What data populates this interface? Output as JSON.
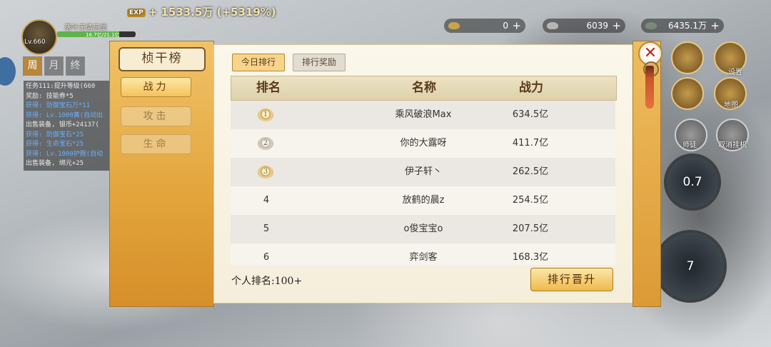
{
  "hud": {
    "exp_badge": "EXP",
    "exp_text": "+ 1533.5万 (+5319%)",
    "player_level": "Lv.660",
    "player_name": "落叶无情忘属",
    "hp_text": "16.7亿/21.1亿",
    "hp_fraction": 0.79,
    "resources": [
      {
        "icon": "gold-ingot-icon",
        "value": "0"
      },
      {
        "icon": "silver-ingot-icon",
        "value": "6039"
      },
      {
        "icon": "copper-coin-icon",
        "value": "6435.1万"
      }
    ],
    "plus": "+",
    "time_tabs": [
      "周",
      "月",
      "终"
    ]
  },
  "quest_log": [
    {
      "text": "任务111:提升等级(660",
      "cls": ""
    },
    {
      "text": "奖励: 技能券*5",
      "cls": ""
    },
    {
      "text": "获得: 防御宝石万*11",
      "cls": "b"
    },
    {
      "text": "获得: Lv.1000黄(自动出",
      "cls": "b"
    },
    {
      "text": "出售装备, 银币+24137(",
      "cls": ""
    },
    {
      "text": "获得: 防御宝石*25",
      "cls": "b"
    },
    {
      "text": "获得: 生命宝石*25",
      "cls": "b"
    },
    {
      "text": "获得: Lv.1000护腕(自动",
      "cls": "b"
    },
    {
      "text": "出售装备, 绑元+25",
      "cls": ""
    }
  ],
  "right_hud": {
    "icons": [
      {
        "name": "welfare-icon",
        "label": "福利"
      },
      {
        "name": "settings-icon",
        "label": "设置"
      },
      {
        "name": "world-map-icon",
        "label": "地图"
      },
      {
        "name": "ranking-icon",
        "label": "地图"
      }
    ],
    "mentor_label": "师徒",
    "cancel_auto_label": "取消挂机",
    "skill_cd_1": "0.7",
    "skill_cd_2": "7"
  },
  "dialog": {
    "title": "桢干榜",
    "side_tabs": [
      "战力",
      "攻击",
      "生命"
    ],
    "top_tabs": [
      "今日排行",
      "排行奖励"
    ],
    "headers": [
      "排名",
      "名称",
      "战力"
    ],
    "rows": [
      {
        "rank": "1",
        "name": "乘风破浪Max",
        "power": "634.5亿",
        "medal": true
      },
      {
        "rank": "2",
        "name": "你的大露呀",
        "power": "411.7亿",
        "medal": true
      },
      {
        "rank": "3",
        "name": "伊子轩丶",
        "power": "262.5亿",
        "medal": true
      },
      {
        "rank": "4",
        "name": "放鹤的晨z",
        "power": "254.5亿",
        "medal": false
      },
      {
        "rank": "5",
        "name": "o俊宝宝o",
        "power": "207.5亿",
        "medal": false
      },
      {
        "rank": "6",
        "name": "弈剑客",
        "power": "168.3亿",
        "medal": false
      }
    ],
    "personal_rank": "个人排名:100+",
    "promote_button": "排行晋升",
    "close": "✕"
  }
}
